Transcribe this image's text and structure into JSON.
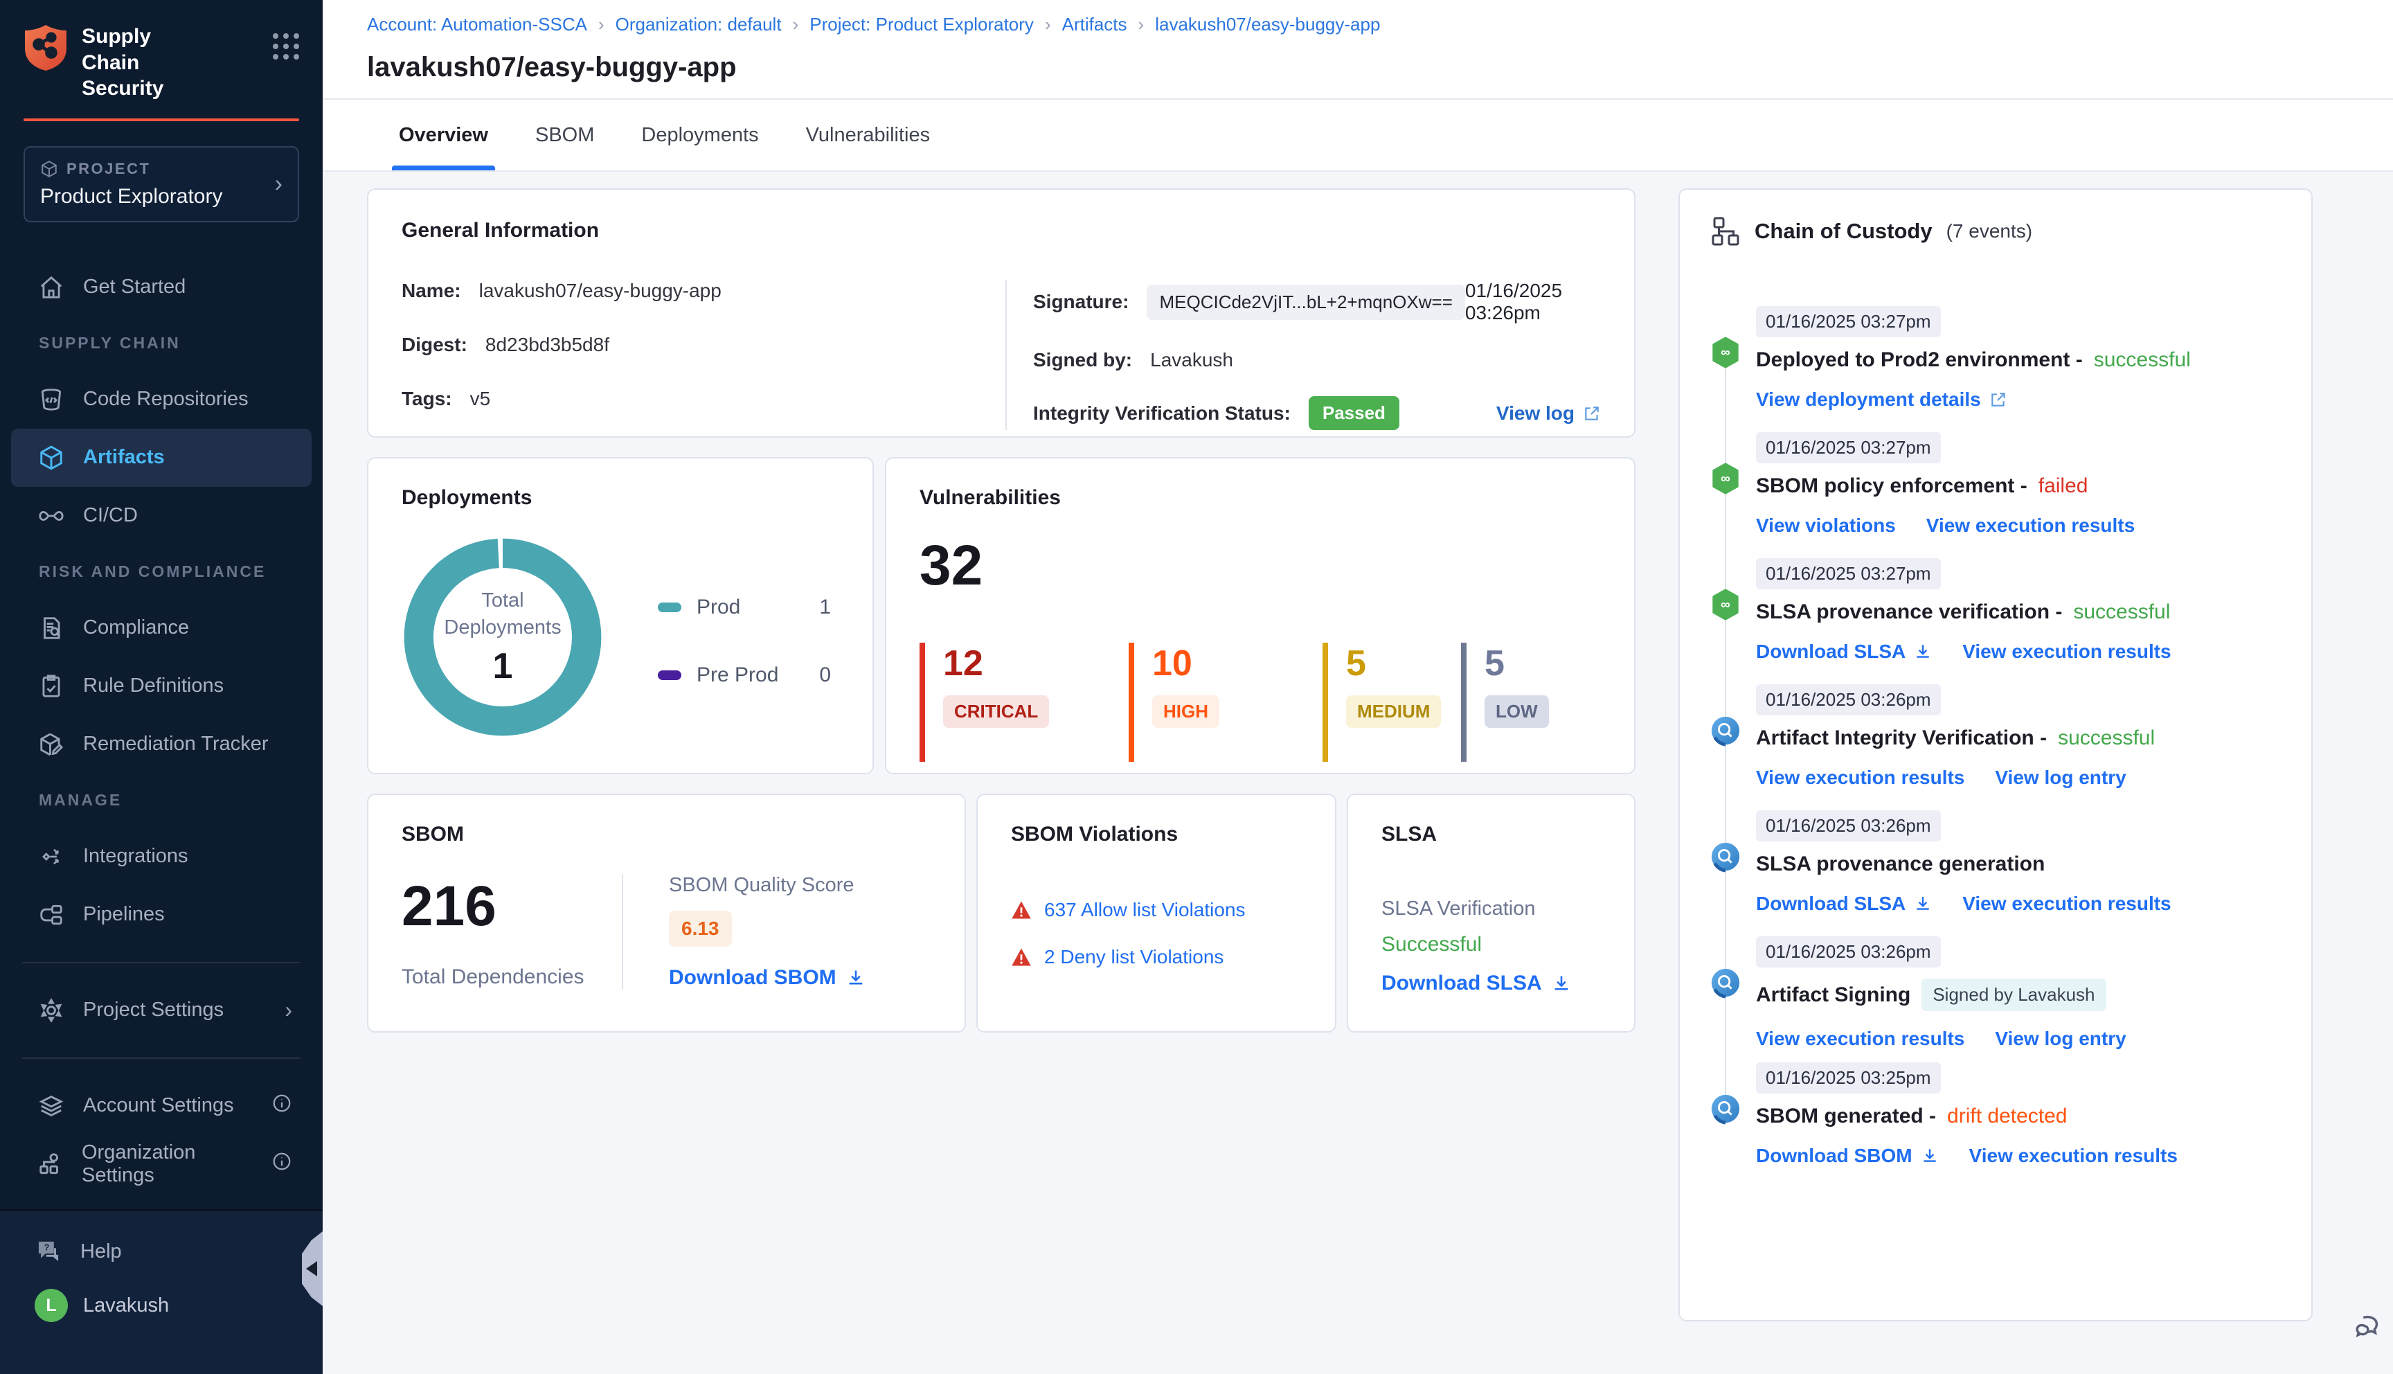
{
  "colors": {
    "brand_orange": "#F2563F",
    "sidebar_bg": "#0D1B2E",
    "active_nav_blue": "#4ABAF6",
    "link_blue": "#1F6EF2",
    "breadcrumb_blue": "#2B76E0",
    "success_green": "#43A84C",
    "passed_badge_green": "#4CAF50",
    "failed_red": "#DD3226",
    "drift_orange": "#FF5310",
    "donut_teal": "#4AA7B2",
    "preprod_purple": "#4A1F9E",
    "critical_red": "#B01F15",
    "high_orange": "#FF5310",
    "medium_amber": "#CC9B0A",
    "low_slate": "#6E7899",
    "quality_score_orange": "#E8631A"
  },
  "sidebar": {
    "app_title": "Supply Chain Security",
    "project_kicker": "PROJECT",
    "project_name": "Product Exploratory",
    "nav": {
      "get_started": "Get Started",
      "supply_chain_header": "SUPPLY CHAIN",
      "code_repositories": "Code Repositories",
      "artifacts": "Artifacts",
      "cicd": "CI/CD",
      "risk_header": "RISK AND COMPLIANCE",
      "compliance": "Compliance",
      "rule_definitions": "Rule Definitions",
      "remediation_tracker": "Remediation Tracker",
      "manage_header": "MANAGE",
      "integrations": "Integrations",
      "pipelines": "Pipelines",
      "project_settings": "Project Settings",
      "account_settings": "Account Settings",
      "organization_settings": "Organization Settings",
      "help": "Help",
      "user_name": "Lavakush",
      "user_initial": "L"
    }
  },
  "breadcrumb": [
    "Account: Automation-SSCA",
    "Organization: default",
    "Project: Product Exploratory",
    "Artifacts",
    "lavakush07/easy-buggy-app"
  ],
  "header": {
    "title": "lavakush07/easy-buggy-app",
    "tabs": [
      "Overview",
      "SBOM",
      "Deployments",
      "Vulnerabilities"
    ],
    "active_tab": "Overview"
  },
  "general_info": {
    "title": "General Information",
    "name_label": "Name:",
    "name": "lavakush07/easy-buggy-app",
    "digest_label": "Digest:",
    "digest": "8d23bd3b5d8f",
    "tags_label": "Tags:",
    "tags": "v5",
    "signature_label": "Signature:",
    "signature": "MEQCICde2VjIT...bL+2+mqnOXw==",
    "signature_time": "01/16/2025 03:26pm",
    "signed_by_label": "Signed by:",
    "signed_by": "Lavakush",
    "integrity_label": "Integrity Verification Status:",
    "integrity_status": "Passed",
    "view_log": "View log"
  },
  "deployments": {
    "title": "Deployments",
    "center_label": "Total Deployments",
    "total": "1",
    "legend": [
      {
        "label": "Prod",
        "value": "1",
        "color": "#4AA7B2"
      },
      {
        "label": "Pre Prod",
        "value": "0",
        "color": "#4A1F9E"
      }
    ]
  },
  "chart_data": {
    "type": "pie",
    "title": "Total Deployments",
    "categories": [
      "Prod",
      "Pre Prod"
    ],
    "values": [
      1,
      0
    ],
    "colors": [
      "#4AA7B2",
      "#4A1F9E"
    ],
    "center_total": 1,
    "legend_position": "right"
  },
  "vulnerabilities": {
    "title": "Vulnerabilities",
    "total": "32",
    "severities": [
      {
        "count": "12",
        "label": "CRITICAL"
      },
      {
        "count": "10",
        "label": "HIGH"
      },
      {
        "count": "5",
        "label": "MEDIUM"
      },
      {
        "count": "5",
        "label": "LOW"
      }
    ]
  },
  "sbom": {
    "title": "SBOM",
    "total": "216",
    "total_label": "Total Dependencies",
    "quality_label": "SBOM Quality Score",
    "quality_score": "6.13",
    "download": "Download SBOM"
  },
  "sbom_violations": {
    "title": "SBOM Violations",
    "items": [
      {
        "text": "637 Allow list Violations"
      },
      {
        "text": "2 Deny list Violations"
      }
    ]
  },
  "slsa": {
    "title": "SLSA",
    "verification_label": "SLSA Verification",
    "verification_status": "Successful",
    "download": "Download SLSA"
  },
  "chain": {
    "title": "Chain of Custody",
    "events_count": "(7 events)",
    "events": [
      {
        "time": "01/16/2025 03:27pm",
        "name": "Deployed to Prod2 environment -",
        "status": "successful",
        "links": [
          {
            "text": "View deployment details"
          }
        ]
      },
      {
        "time": "01/16/2025 03:27pm",
        "name": "SBOM policy enforcement -",
        "status": "failed",
        "links": [
          {
            "text": "View violations"
          },
          {
            "text": "View execution results"
          }
        ]
      },
      {
        "time": "01/16/2025 03:27pm",
        "name": "SLSA provenance verification -",
        "status": "successful",
        "links": [
          {
            "text": "Download SLSA"
          },
          {
            "text": "View execution results"
          }
        ]
      },
      {
        "time": "01/16/2025 03:26pm",
        "name": "Artifact Integrity Verification -",
        "status": "successful",
        "links": [
          {
            "text": "View execution results"
          },
          {
            "text": "View log entry"
          }
        ]
      },
      {
        "time": "01/16/2025 03:26pm",
        "name": "SLSA provenance generation",
        "status": "",
        "links": [
          {
            "text": "Download SLSA"
          },
          {
            "text": "View execution results"
          }
        ]
      },
      {
        "time": "01/16/2025 03:26pm",
        "name": "Artifact Signing",
        "badge": "Signed by Lavakush",
        "links": [
          {
            "text": "View execution results"
          },
          {
            "text": "View log entry"
          }
        ]
      },
      {
        "time": "01/16/2025 03:25pm",
        "name": "SBOM generated -",
        "status": "drift detected",
        "links": [
          {
            "text": "Download SBOM"
          },
          {
            "text": "View execution results"
          }
        ]
      }
    ]
  }
}
